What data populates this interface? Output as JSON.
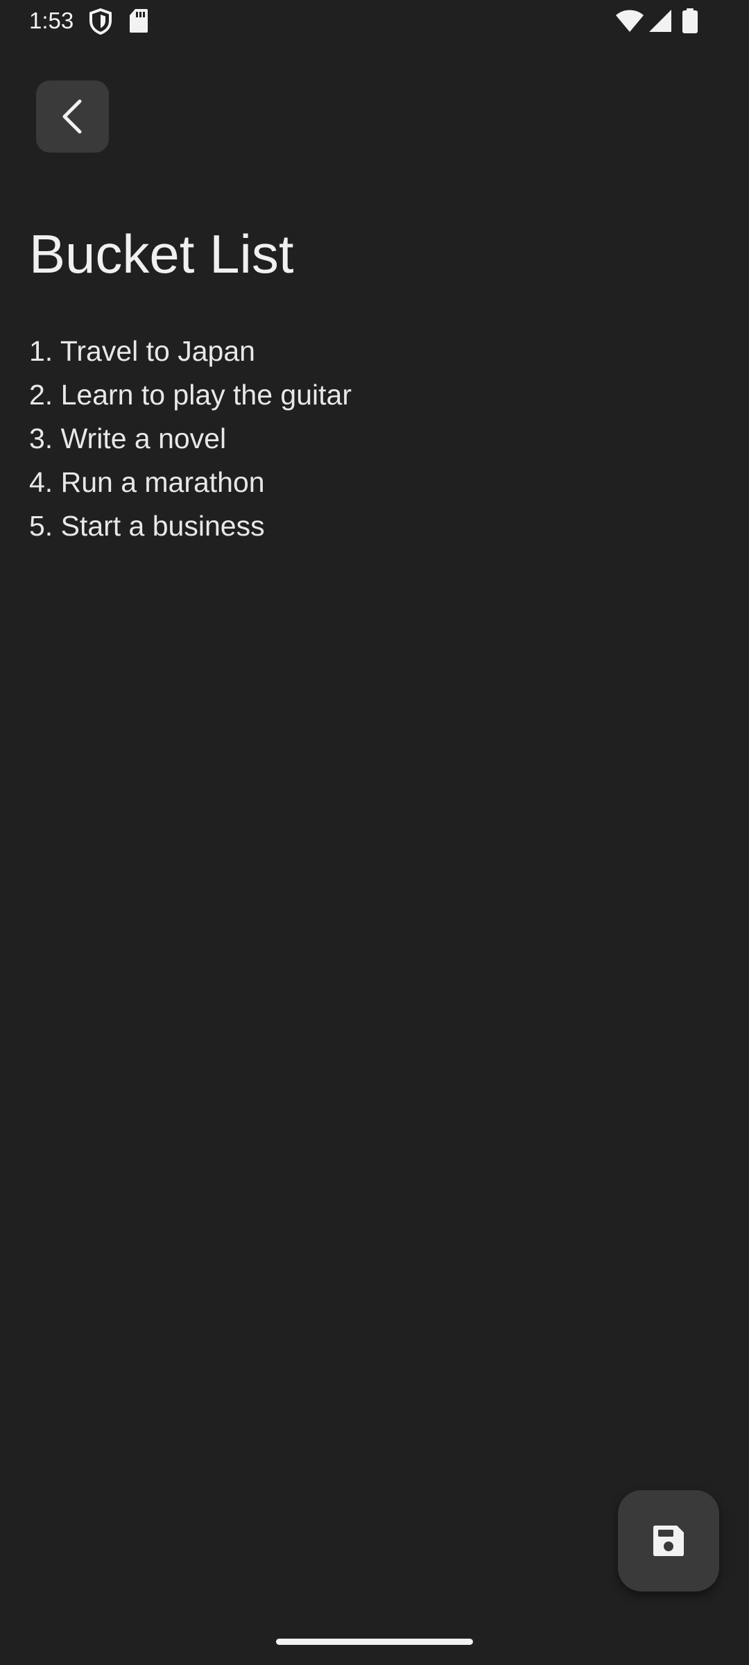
{
  "status_bar": {
    "time": "1:53",
    "icons": [
      "shield-icon",
      "sdcard-icon",
      "wifi-icon",
      "signal-icon",
      "battery-icon"
    ]
  },
  "toolbar": {
    "back_icon": "chevron-left-icon"
  },
  "note": {
    "title": "Bucket List",
    "lines": [
      "1. Travel to Japan",
      "2. Learn to play the guitar",
      "3. Write a novel",
      "4. Run a marathon",
      "5. Start a business"
    ]
  },
  "fab": {
    "icon": "save-icon"
  },
  "colors": {
    "background": "#202020",
    "surface": "#3A3A3A",
    "text": "#ECECEC"
  }
}
